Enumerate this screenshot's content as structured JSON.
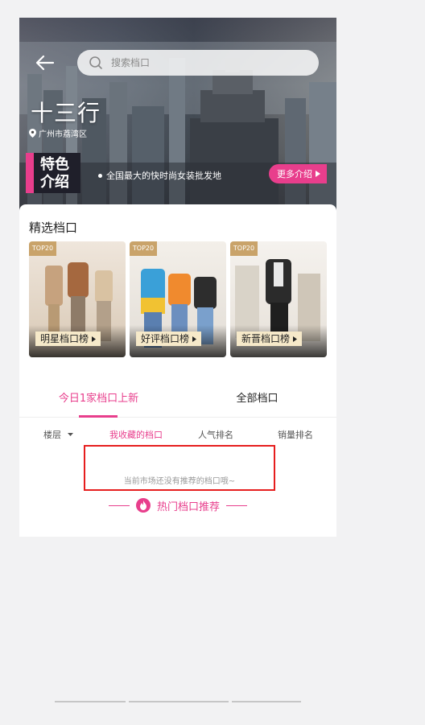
{
  "header": {
    "search_placeholder": "搜索档口",
    "title": "十三行",
    "location": "广州市荔湾区"
  },
  "feature": {
    "tag_line1": "特色",
    "tag_line2": "介绍",
    "description": "全国最大的快时尚女装批发地",
    "more_label": "更多介绍"
  },
  "selected": {
    "title": "精选档口",
    "items": [
      {
        "badge": "TOP20",
        "label": "明星档口榜"
      },
      {
        "badge": "TOP20",
        "label": "好评档口榜"
      },
      {
        "badge": "TOP20",
        "label": "新晋档口榜"
      }
    ]
  },
  "tabs": [
    {
      "label": "今日1家档口上新",
      "active": true
    },
    {
      "label": "全部档口",
      "active": false
    }
  ],
  "filters": {
    "floor": "楼层",
    "favorite": "我收藏的档口",
    "popularity": "人气排名",
    "sales": "销量排名"
  },
  "empty_message": "当前市场还没有推荐的档口哦~",
  "hot_recommend": "热门档口推荐",
  "colors": {
    "accent": "#e83e8c",
    "highlight_box": "#e61e1e",
    "badge_gold": "#c9a36a"
  }
}
